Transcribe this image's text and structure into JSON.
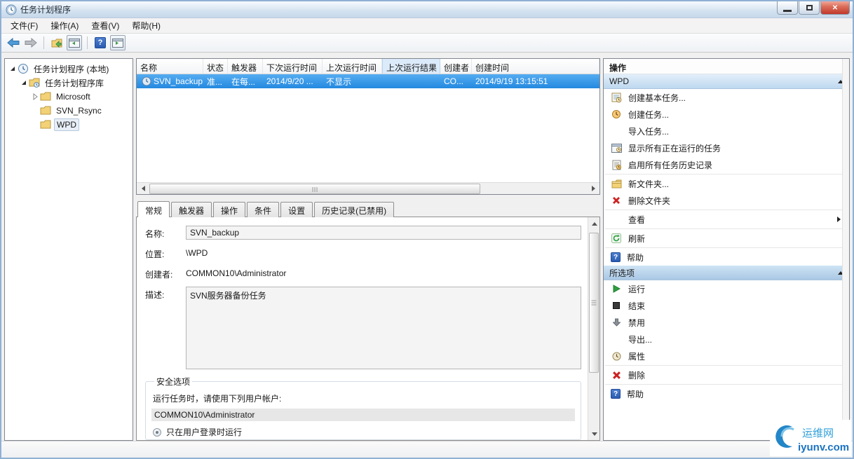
{
  "window": {
    "title": "任务计划程序",
    "controls": {
      "minimize": "minimize",
      "restore": "restore",
      "close": "close"
    }
  },
  "menu": {
    "items": [
      "文件(F)",
      "操作(A)",
      "查看(V)",
      "帮助(H)"
    ]
  },
  "tree": {
    "root": "任务计划程序 (本地)",
    "library": "任务计划程序库",
    "children": [
      {
        "label": "Microsoft"
      },
      {
        "label": "SVN_Rsync"
      },
      {
        "label": "WPD"
      }
    ]
  },
  "task_list": {
    "columns": [
      "名称",
      "状态",
      "触发器",
      "下次运行时间",
      "上次运行时间",
      "上次运行结果",
      "创建者",
      "创建时间"
    ],
    "row": {
      "name": "SVN_backup",
      "status": "准...",
      "trigger": "在每...",
      "next_run": "2014/9/20 ...",
      "last_run": "不显示",
      "last_result": "",
      "author": "CO...",
      "created": "2014/9/19 13:15:51"
    }
  },
  "tabs": [
    "常规",
    "触发器",
    "操作",
    "条件",
    "设置",
    "历史记录(已禁用)"
  ],
  "general": {
    "name_label": "名称:",
    "name_value": "SVN_backup",
    "location_label": "位置:",
    "location_value": "\\WPD",
    "author_label": "创建者:",
    "author_value": "COMMON10\\Administrator",
    "desc_label": "描述:",
    "desc_value": "SVN服务器备份任务"
  },
  "security": {
    "legend": "安全选项",
    "line1": "运行任务时，请使用下列用户帐户:",
    "account": "COMMON10\\Administrator",
    "radio_label": "只在用户登录时运行"
  },
  "actions": {
    "title": "操作",
    "wpd": {
      "title": "WPD",
      "items": [
        "创建基本任务...",
        "创建任务...",
        "导入任务...",
        "显示所有正在运行的任务",
        "启用所有任务历史记录",
        "新文件夹...",
        "删除文件夹",
        "查看",
        "刷新",
        "帮助"
      ]
    },
    "selected": {
      "title": "所选项",
      "items": [
        "运行",
        "结束",
        "禁用",
        "导出...",
        "属性",
        "删除",
        "帮助"
      ]
    }
  },
  "watermark": {
    "text": "运维网",
    "domain": "iyunv.com"
  },
  "colors": {
    "selection": "#2389e0",
    "header_sorted": "#dcebfa",
    "close_red": "#c0392b"
  }
}
